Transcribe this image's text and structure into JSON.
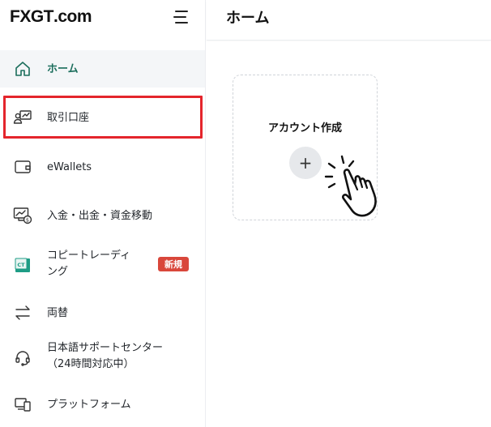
{
  "brand": {
    "logo_text_fx": "FX",
    "logo_text_gt": "GT",
    "logo_text_domain": ".com"
  },
  "header": {
    "title": "ホーム"
  },
  "sidebar": {
    "items": [
      {
        "label": "ホーム",
        "icon": "home-icon",
        "active": true
      },
      {
        "label": "取引口座",
        "icon": "trading-account-icon",
        "active": false
      },
      {
        "label": "eWallets",
        "icon": "wallet-icon",
        "active": false
      },
      {
        "label": "入金・出金・資金移動",
        "icon": "deposit-withdraw-icon",
        "active": false
      },
      {
        "label_line1": "コピートレーディ",
        "label_line2": "ング",
        "icon": "copy-trading-icon",
        "badge": "新規",
        "active": false
      },
      {
        "label": "両替",
        "icon": "exchange-icon",
        "active": false
      },
      {
        "label_line1": "日本語サポートセンター",
        "label_line2": "（24時間対応中）",
        "icon": "headset-icon",
        "active": false
      },
      {
        "label": "プラットフォーム",
        "icon": "platform-icon",
        "active": false
      }
    ]
  },
  "main": {
    "card": {
      "title": "アカウント作成",
      "plus": "+"
    }
  },
  "colors": {
    "accent": "#1b6e5c",
    "highlight": "#e4252c",
    "badge": "#d9473b"
  }
}
